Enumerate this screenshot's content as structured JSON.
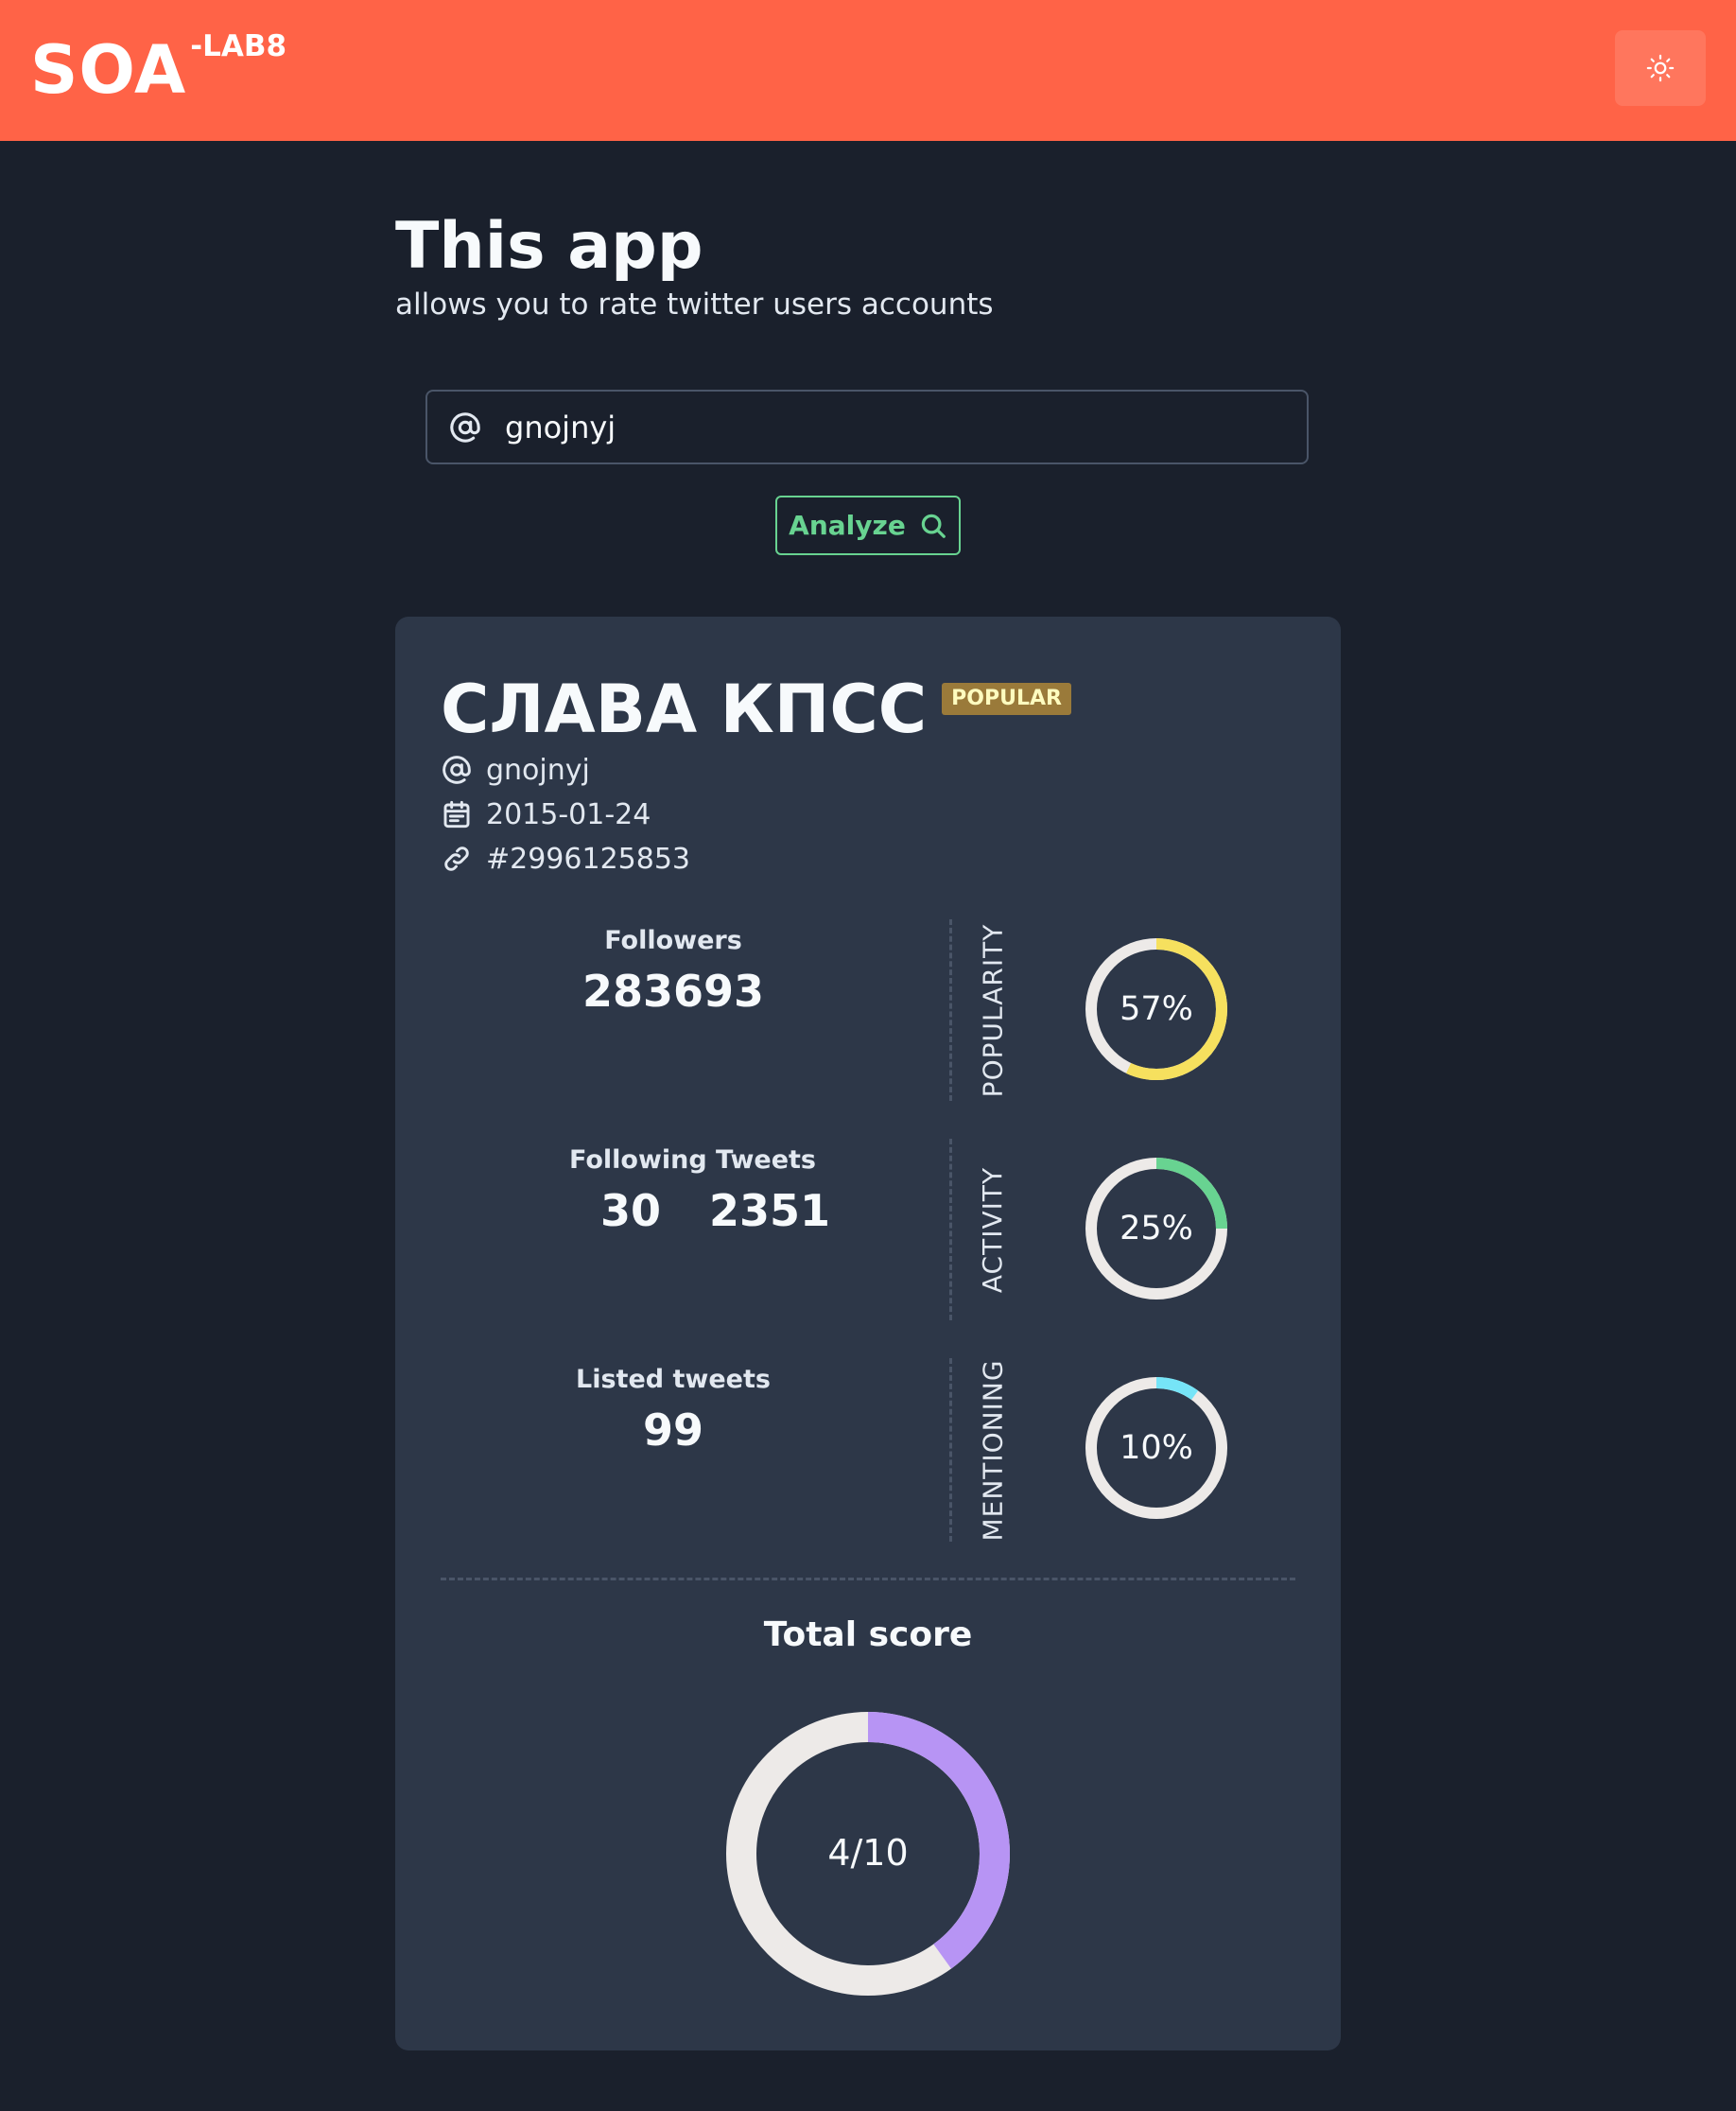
{
  "header": {
    "logo": "SOA",
    "logo_sup": "-LAB8",
    "theme_toggle_icon": "sun-icon"
  },
  "intro": {
    "title": "This app",
    "subtitle": "allows you to rate twitter users accounts"
  },
  "search": {
    "icon": "at-icon",
    "value": "gnojnyj",
    "placeholder": ""
  },
  "analyze_button": {
    "label": "Analyze",
    "icon": "search-icon"
  },
  "profile": {
    "name": "СЛАВА КПСС",
    "badge": "POPULAR",
    "username": "gnojnyj",
    "created": "2015-01-24",
    "id": "#2996125853"
  },
  "stats": {
    "followers_label": "Followers",
    "followers_value": "283693",
    "following_label": "Following",
    "following_value": "30",
    "tweets_label": "Tweets",
    "tweets_value": "2351",
    "listed_label": "Listed tweets",
    "listed_value": "99"
  },
  "scores": {
    "popularity": {
      "label": "POPULARITY",
      "text": "57%",
      "fraction": 0.57,
      "color": "#f6e05e"
    },
    "activity": {
      "label": "ACTIVITY",
      "text": "25%",
      "fraction": 0.25,
      "color": "#68d391"
    },
    "mentioning": {
      "label": "MENTIONING",
      "text": "10%",
      "fraction": 0.1,
      "color": "#76e4f7"
    }
  },
  "total": {
    "label": "Total score",
    "text": "4/10",
    "fraction": 0.4,
    "color": "#b794f4"
  },
  "colors": {
    "header_bg": "#ff6347",
    "page_bg": "#1a202c",
    "card_bg": "#2d3748",
    "accent_green": "#68d391",
    "track": "#edeae8"
  }
}
